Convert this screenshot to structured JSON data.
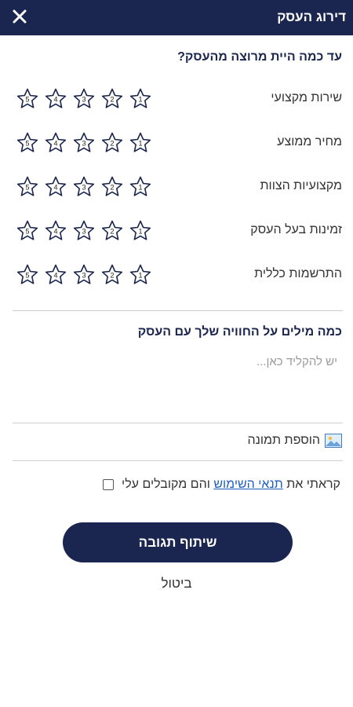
{
  "header": {
    "title": "דירוג העסק",
    "close_icon": "close-icon"
  },
  "question": "עד כמה היית מרוצה מהעסק?",
  "rating_labels": [
    "שירות מקצועי",
    "מחיר ממוצע",
    "מקצועיות הצוות",
    "זמינות בעל העסק",
    "התרשמות כללית"
  ],
  "star_numbers": [
    "1",
    "2",
    "3",
    "4",
    "5"
  ],
  "comment": {
    "title": "כמה מילים על החוויה שלך עם העסק",
    "placeholder": "יש להקליד כאן...",
    "value": ""
  },
  "add_photo": {
    "label": "הוספת תמונה",
    "icon": "image-icon"
  },
  "terms": {
    "prefix": "קראתי את",
    "link": "תנאי השימוש",
    "suffix": "והם מקובלים עלי",
    "checked": false
  },
  "submit_label": "שיתוף תגובה",
  "cancel_label": "ביטול",
  "colors": {
    "brand": "#1b2650",
    "link": "#1f5fbf",
    "star_stroke": "#1b2650"
  }
}
